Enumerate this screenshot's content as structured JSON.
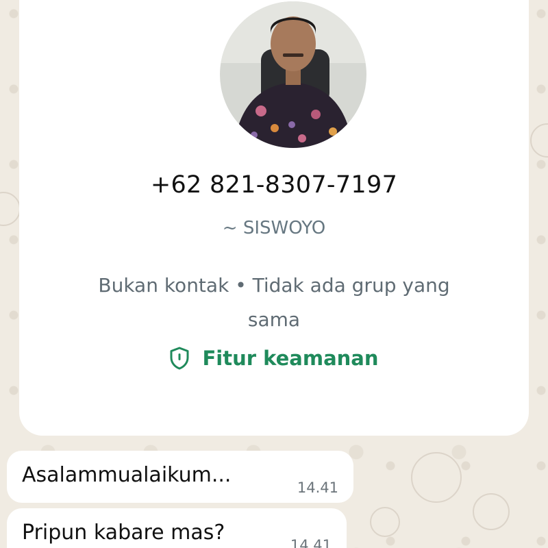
{
  "contact": {
    "phone": "+62 821-8307-7197",
    "push_name": "~ SISWOYO",
    "relation": "Bukan kontak • Tidak ada grup yang sama",
    "security_label": "Fitur keamanan"
  },
  "messages": [
    {
      "text": "Asalammualaikum...",
      "time": "14.41"
    },
    {
      "text": "Pripun kabare mas?",
      "time": "14.41"
    }
  ],
  "colors": {
    "accent": "#1f8a5b",
    "wallpaper": "#f0ebe2",
    "card": "#ffffff",
    "secondary_text": "#667781"
  },
  "icons": {
    "security": "shield-icon"
  }
}
